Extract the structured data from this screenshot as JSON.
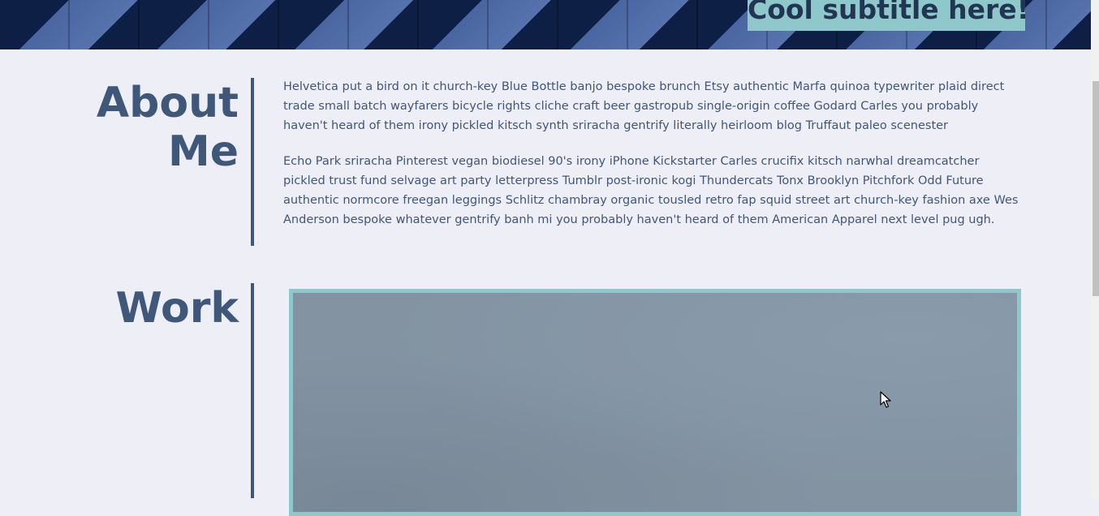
{
  "header": {
    "subtitle": "Cool subtitle here!"
  },
  "about": {
    "title_line1": "About",
    "title_line2": "Me",
    "paragraphs": [
      "Helvetica put a bird on it church-key Blue Bottle banjo bespoke brunch Etsy authentic Marfa quinoa typewriter plaid direct trade small batch wayfarers bicycle rights cliche craft beer gastropub single-origin coffee Godard Carles you probably haven't heard of them irony pickled kitsch synth sriracha gentrify literally heirloom blog Truffaut paleo scenester",
      "Echo Park sriracha Pinterest vegan biodiesel 90's irony iPhone Kickstarter Carles crucifix kitsch narwhal dreamcatcher pickled trust fund selvage art party letterpress Tumblr post-ironic kogi Thundercats Tonx Brooklyn Pitchfork Odd Future authentic normcore freegan leggings Schlitz chambray organic tousled retro fap squid street art church-key fashion axe Wes Anderson bespoke whatever gentrify banh mi you probably haven't heard of them American Apparel next level pug ugh."
    ]
  },
  "work": {
    "title": "Work"
  },
  "colors": {
    "accent": "#8ec8ca",
    "heading": "#3f5778",
    "background": "#eeeef6"
  },
  "icons": {
    "cursor": "mouse-pointer-icon"
  }
}
